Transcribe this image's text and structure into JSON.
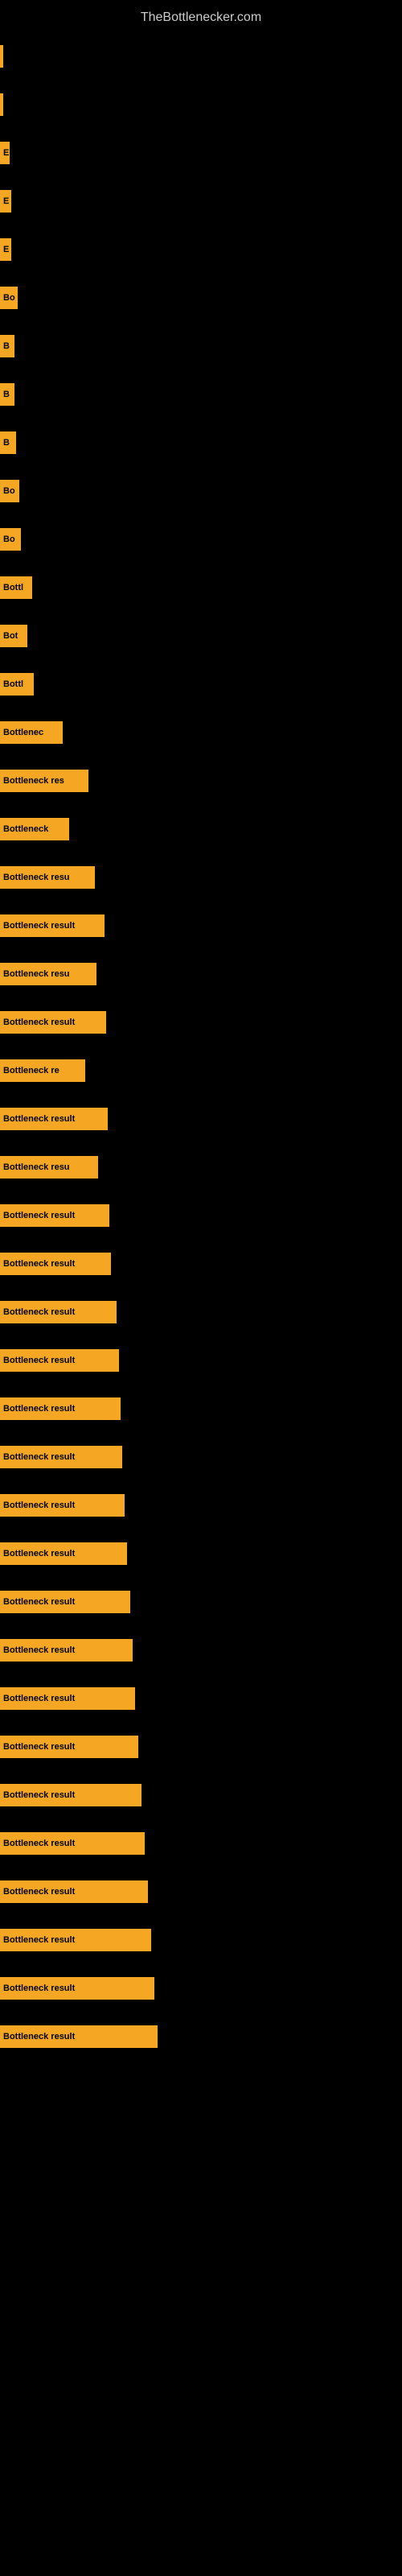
{
  "site": {
    "title": "TheBottlenecker.com"
  },
  "bars": [
    {
      "id": 1,
      "label": "",
      "width": 4
    },
    {
      "id": 2,
      "label": "",
      "width": 4
    },
    {
      "id": 3,
      "label": "E",
      "width": 12
    },
    {
      "id": 4,
      "label": "E",
      "width": 14
    },
    {
      "id": 5,
      "label": "E",
      "width": 14
    },
    {
      "id": 6,
      "label": "Bo",
      "width": 22
    },
    {
      "id": 7,
      "label": "B",
      "width": 18
    },
    {
      "id": 8,
      "label": "B",
      "width": 18
    },
    {
      "id": 9,
      "label": "B",
      "width": 20
    },
    {
      "id": 10,
      "label": "Bo",
      "width": 24
    },
    {
      "id": 11,
      "label": "Bo",
      "width": 26
    },
    {
      "id": 12,
      "label": "Bottl",
      "width": 40
    },
    {
      "id": 13,
      "label": "Bot",
      "width": 34
    },
    {
      "id": 14,
      "label": "Bottl",
      "width": 42
    },
    {
      "id": 15,
      "label": "Bottlenec",
      "width": 78
    },
    {
      "id": 16,
      "label": "Bottleneck res",
      "width": 110
    },
    {
      "id": 17,
      "label": "Bottleneck",
      "width": 86
    },
    {
      "id": 18,
      "label": "Bottleneck resu",
      "width": 118
    },
    {
      "id": 19,
      "label": "Bottleneck result",
      "width": 130
    },
    {
      "id": 20,
      "label": "Bottleneck resu",
      "width": 120
    },
    {
      "id": 21,
      "label": "Bottleneck result",
      "width": 132
    },
    {
      "id": 22,
      "label": "Bottleneck re",
      "width": 106
    },
    {
      "id": 23,
      "label": "Bottleneck result",
      "width": 134
    },
    {
      "id": 24,
      "label": "Bottleneck resu",
      "width": 122
    },
    {
      "id": 25,
      "label": "Bottleneck result",
      "width": 136
    },
    {
      "id": 26,
      "label": "Bottleneck result",
      "width": 138
    },
    {
      "id": 27,
      "label": "Bottleneck result",
      "width": 145
    },
    {
      "id": 28,
      "label": "Bottleneck result",
      "width": 148
    },
    {
      "id": 29,
      "label": "Bottleneck result",
      "width": 150
    },
    {
      "id": 30,
      "label": "Bottleneck result",
      "width": 152
    },
    {
      "id": 31,
      "label": "Bottleneck result",
      "width": 155
    },
    {
      "id": 32,
      "label": "Bottleneck result",
      "width": 158
    },
    {
      "id": 33,
      "label": "Bottleneck result",
      "width": 162
    },
    {
      "id": 34,
      "label": "Bottleneck result",
      "width": 165
    },
    {
      "id": 35,
      "label": "Bottleneck result",
      "width": 168
    },
    {
      "id": 36,
      "label": "Bottleneck result",
      "width": 172
    },
    {
      "id": 37,
      "label": "Bottleneck result",
      "width": 176
    },
    {
      "id": 38,
      "label": "Bottleneck result",
      "width": 180
    },
    {
      "id": 39,
      "label": "Bottleneck result",
      "width": 184
    },
    {
      "id": 40,
      "label": "Bottleneck result",
      "width": 188
    },
    {
      "id": 41,
      "label": "Bottleneck result",
      "width": 192
    },
    {
      "id": 42,
      "label": "Bottleneck result",
      "width": 196
    }
  ]
}
